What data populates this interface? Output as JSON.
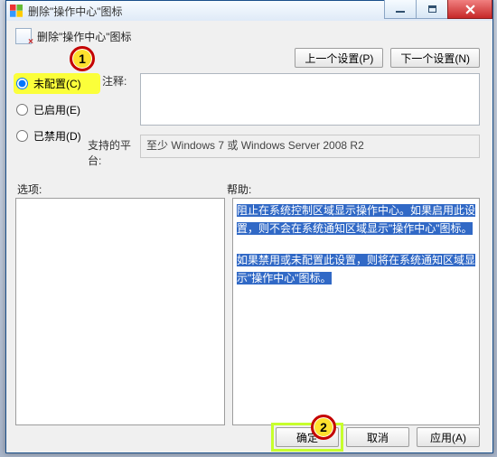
{
  "window": {
    "title": "删除\"操作中心\"图标"
  },
  "header": {
    "title": "删除\"操作中心\"图标"
  },
  "nav": {
    "prev": "上一个设置(P)",
    "next": "下一个设置(N)"
  },
  "radios": {
    "not_configured": "未配置(C)",
    "enabled": "已启用(E)",
    "disabled": "已禁用(D)",
    "selected": "not_configured"
  },
  "remarks": {
    "label": "注释:",
    "value": ""
  },
  "platform": {
    "label": "支持的平台:",
    "value": "至少 Windows 7 或 Windows Server 2008 R2"
  },
  "sections": {
    "options": "选项:",
    "help": "帮助:"
  },
  "help_text": {
    "p1": "阻止在系统控制区域显示操作中心。如果启用此设置，则不会在系统通知区域显示\"操作中心\"图标。",
    "p2": "如果禁用或未配置此设置，则将在系统通知区域显示\"操作中心\"图标。"
  },
  "actions": {
    "ok": "确定",
    "cancel": "取消",
    "apply": "应用(A)"
  },
  "annotations": {
    "b1": "1",
    "b2": "2"
  }
}
